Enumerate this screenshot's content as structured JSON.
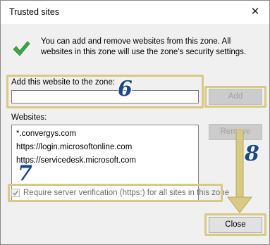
{
  "window": {
    "title": "Trusted sites",
    "close_glyph": "✕"
  },
  "info": {
    "icon": "green-check-icon",
    "text": "You can add and remove websites from this zone. All websites in this zone will use the zone's security settings."
  },
  "add": {
    "label": "Add this website to the zone:",
    "value": "",
    "button": "Add"
  },
  "websites": {
    "label": "Websites:",
    "items": [
      "*.convergys.com",
      "https://login.microsoftonline.com",
      "https://servicedesk.microsoft.com"
    ],
    "remove_button": "Remove"
  },
  "verification": {
    "checked": true,
    "label": "Require server verification (https:) for all sites in this zone"
  },
  "close_button": "Close",
  "annotations": {
    "step_6": "6",
    "step_7": "7",
    "step_8": "8",
    "highlight_color": "#d8c983",
    "number_color": "#1a4a86"
  }
}
